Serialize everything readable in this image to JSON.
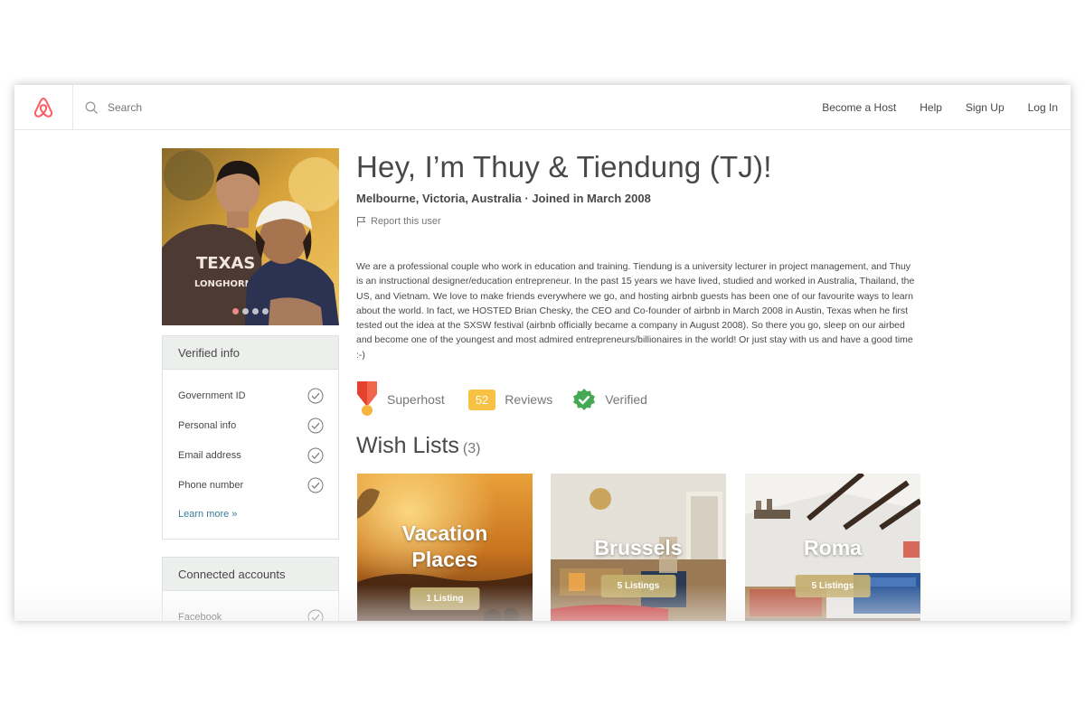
{
  "header": {
    "search_placeholder": "Search",
    "nav": [
      "Become a Host",
      "Help",
      "Sign Up",
      "Log In"
    ]
  },
  "profile": {
    "title": "Hey, I’m Thuy & Tiendung (TJ)!",
    "subtitle": "Melbourne, Victoria, Australia · Joined in March 2008",
    "report": "Report this user",
    "about": "We are a professional couple who work in education and training. Tiendung is a university lecturer in project management, and Thuy is an instructional designer/education entrepreneur. In the past 15 years we have lived, studied and worked in Australia, Thailand, the US, and Vietnam. We love to make friends everywhere we go, and hosting airbnb guests has been one of our favourite ways to learn about the world. In fact, we HOSTED Brian Chesky, the CEO and Co-founder of airbnb in March 2008 in Austin, Texas when he first tested out the idea at the SXSW festival (airbnb officially became a company in August 2008). So there you go, sleep on our airbed and become one of the youngest and most admired entrepreneurs/billionaires in the world! Or just stay with us and have a good time :-)"
  },
  "photo": {
    "shirt_text_1": "TEXAS",
    "shirt_text_2": "LONGHORNS"
  },
  "verified_info": {
    "heading": "Verified info",
    "items": [
      "Government ID",
      "Personal info",
      "Email address",
      "Phone number"
    ],
    "learn_more": "Learn more »"
  },
  "connected_accounts": {
    "heading": "Connected accounts",
    "items": [
      "Facebook"
    ]
  },
  "badges": {
    "superhost": "Superhost",
    "reviews_count": "52",
    "reviews_label": "Reviews",
    "verified": "Verified"
  },
  "wishlists": {
    "heading": "Wish Lists",
    "count": "(3)",
    "cards": [
      {
        "line1": "Vacation",
        "line2": "Places",
        "listings": "1 Listing"
      },
      {
        "line1": "Brussels",
        "listings": "5 Listings"
      },
      {
        "line1": "Roma",
        "listings": "5 Listings"
      }
    ]
  },
  "colors": {
    "brand": "#ff5a5f",
    "link": "#3d7e9a",
    "reviews_badge": "#f7c244",
    "verified_green": "#45a853",
    "superhost_red": "#e6412f",
    "superhost_yellow": "#f6b53c"
  }
}
